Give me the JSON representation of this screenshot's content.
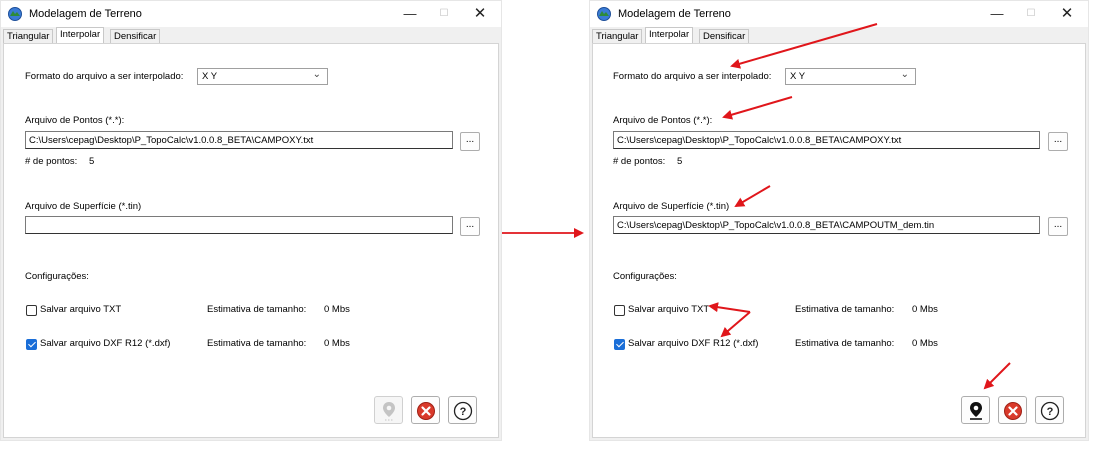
{
  "app_title": "Modelagem de Terreno",
  "window_controls": {
    "minimize": "—",
    "maximize": "☐",
    "close": "✕"
  },
  "tabs": [
    "Triangular",
    "Interpolar",
    "Densificar"
  ],
  "form": {
    "format_label": "Formato do arquivo a ser interpolado:",
    "format_value": "X Y",
    "points_label": "Arquivo de Pontos (*.*):",
    "points_path": "C:\\Users\\cepag\\Desktop\\P_TopoCalc\\v1.0.0.8_BETA\\CAMPOXY.txt",
    "points_count_label": "# de pontos:",
    "points_count": "5",
    "surface_label": "Arquivo de Superfície (*.tin)",
    "browse_label": "...",
    "config_label": "Configurações:",
    "save_txt_label": "Salvar arquivo TXT",
    "save_dxf_label": "Salvar arquivo DXF R12 (*.dxf)",
    "estimate_label": "Estimativa de tamanho:",
    "estimate_value": "0 Mbs"
  },
  "left": {
    "surface_path": "",
    "save_txt_checked": false,
    "save_dxf_checked": true,
    "locate_enabled": false
  },
  "right": {
    "surface_path": "C:\\Users\\cepag\\Desktop\\P_TopoCalc\\v1.0.0.8_BETA\\CAMPOUTM_dem.tin",
    "save_txt_checked": false,
    "save_dxf_checked": true,
    "locate_enabled": true
  },
  "icons": {
    "app": "terrain-app-icon",
    "locate": "map-pin-icon",
    "cancel": "cancel-icon",
    "help": "help-icon"
  },
  "colors": {
    "annotation_arrow": "#e0161b",
    "checkbox_accent": "#1a6ed8",
    "cancel_red": "#d93a2b"
  }
}
